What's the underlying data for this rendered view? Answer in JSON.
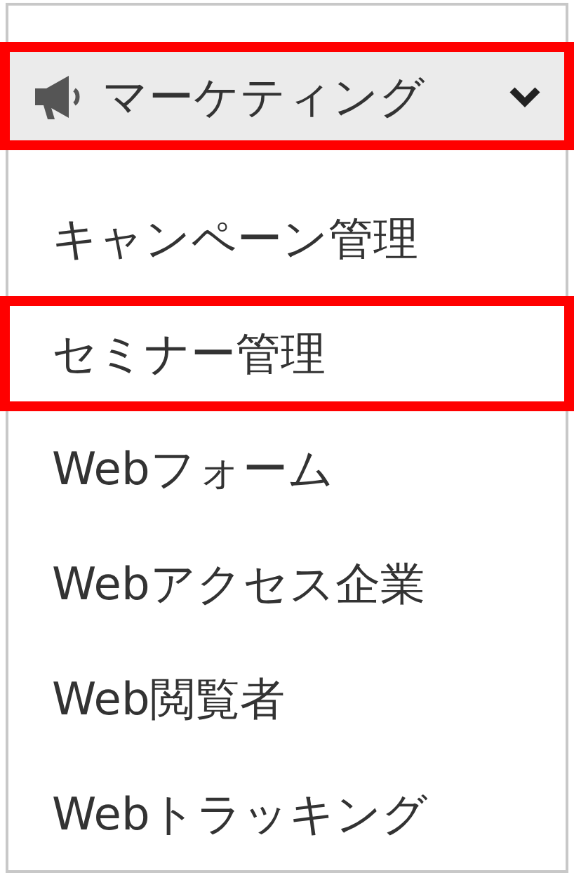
{
  "menu": {
    "header": {
      "label": "マーケティング",
      "highlighted": true,
      "expanded": true
    },
    "items": [
      {
        "label": "キャンペーン管理",
        "highlighted": false
      },
      {
        "label": "セミナー管理",
        "highlighted": true
      },
      {
        "label": "Webフォーム",
        "highlighted": false
      },
      {
        "label": "Webアクセス企業",
        "highlighted": false
      },
      {
        "label": "Web閲覧者",
        "highlighted": false
      },
      {
        "label": "Webトラッキング",
        "highlighted": false
      }
    ]
  }
}
